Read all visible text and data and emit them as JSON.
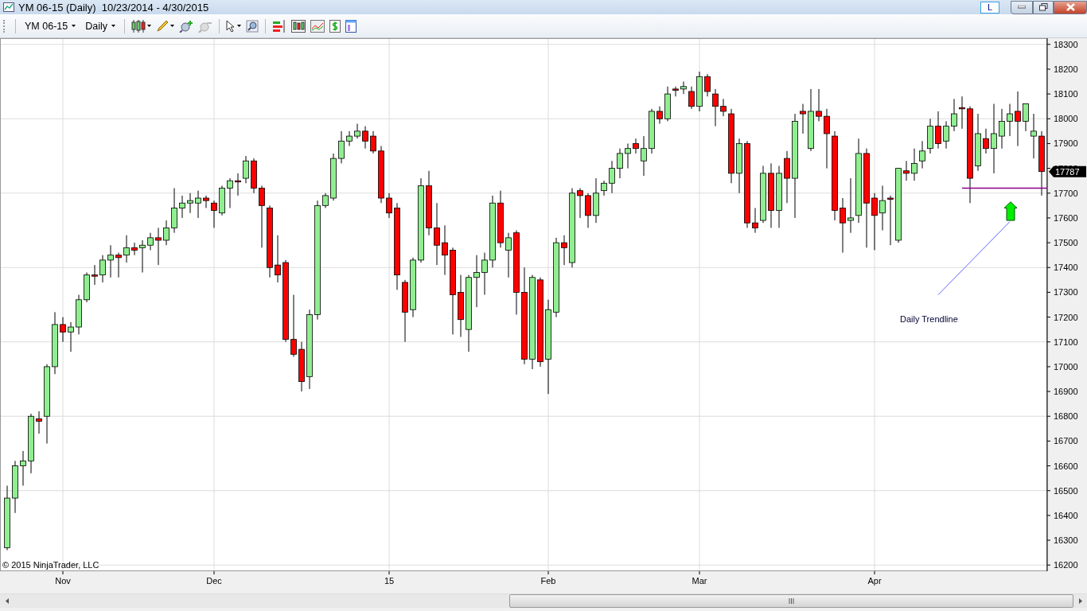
{
  "window": {
    "title": "YM 06-15 (Daily)  10/23/2014 - 4/30/2015",
    "layout_button": "L"
  },
  "toolbar": {
    "instrument": "YM 06-15",
    "interval": "Daily"
  },
  "chart": {
    "copyright": "© 2015 NinjaTrader, LLC",
    "last_price": "17787",
    "chart_data": {
      "type": "candlestick",
      "grid": true,
      "ylim": [
        16175,
        18325
      ],
      "yticks": [
        16200,
        16300,
        16400,
        16500,
        16600,
        16700,
        16800,
        16900,
        17000,
        17100,
        17200,
        17300,
        17400,
        17500,
        17600,
        17700,
        17800,
        17900,
        18000,
        18100,
        18200,
        18300
      ],
      "annotations": [
        "Daily Trendline"
      ],
      "categories": [
        null,
        null,
        null,
        null,
        null,
        null,
        null,
        "Nov",
        null,
        null,
        null,
        null,
        null,
        null,
        null,
        null,
        null,
        null,
        null,
        null,
        null,
        null,
        null,
        null,
        null,
        null,
        "Dec",
        null,
        null,
        null,
        null,
        null,
        null,
        null,
        null,
        null,
        null,
        null,
        null,
        null,
        null,
        null,
        null,
        null,
        null,
        null,
        null,
        null,
        "15",
        null,
        null,
        null,
        null,
        null,
        null,
        null,
        null,
        null,
        null,
        null,
        null,
        null,
        null,
        null,
        null,
        null,
        null,
        null,
        "Feb",
        null,
        null,
        null,
        null,
        null,
        null,
        null,
        null,
        null,
        null,
        null,
        null,
        null,
        null,
        null,
        null,
        null,
        null,
        "Mar",
        null,
        null,
        null,
        null,
        null,
        null,
        null,
        null,
        null,
        null,
        null,
        null,
        null,
        null,
        null,
        null,
        null,
        null,
        null,
        null,
        null,
        "Apr",
        null,
        null,
        null,
        null,
        null,
        null,
        null,
        null,
        null,
        null,
        null,
        null,
        null,
        null,
        null,
        null,
        null,
        null,
        null,
        null,
        null
      ],
      "ohlc": [
        [
          16270,
          16520,
          16260,
          16470
        ],
        [
          16470,
          16620,
          16410,
          16600
        ],
        [
          16600,
          16660,
          16520,
          16620
        ],
        [
          16620,
          16810,
          16570,
          16800
        ],
        [
          16790,
          16820,
          16730,
          16780
        ],
        [
          16800,
          17010,
          16690,
          17000
        ],
        [
          17000,
          17220,
          16970,
          17170
        ],
        [
          17170,
          17200,
          17100,
          17140
        ],
        [
          17140,
          17180,
          17060,
          17160
        ],
        [
          17160,
          17290,
          17130,
          17270
        ],
        [
          17270,
          17380,
          17260,
          17370
        ],
        [
          17370,
          17410,
          17330,
          17365
        ],
        [
          17370,
          17450,
          17340,
          17430
        ],
        [
          17430,
          17490,
          17360,
          17450
        ],
        [
          17450,
          17460,
          17360,
          17440
        ],
        [
          17450,
          17530,
          17420,
          17480
        ],
        [
          17480,
          17500,
          17450,
          17470
        ],
        [
          17480,
          17510,
          17380,
          17490
        ],
        [
          17490,
          17540,
          17470,
          17520
        ],
        [
          17520,
          17560,
          17410,
          17510
        ],
        [
          17510,
          17590,
          17490,
          17560
        ],
        [
          17560,
          17720,
          17540,
          17640
        ],
        [
          17640,
          17690,
          17600,
          17660
        ],
        [
          17660,
          17700,
          17620,
          17670
        ],
        [
          17660,
          17710,
          17600,
          17680
        ],
        [
          17680,
          17690,
          17640,
          17670
        ],
        [
          17660,
          17670,
          17560,
          17630
        ],
        [
          17620,
          17730,
          17610,
          17720
        ],
        [
          17720,
          17760,
          17640,
          17750
        ],
        [
          17750,
          17780,
          17690,
          17745
        ],
        [
          17760,
          17850,
          17740,
          17830
        ],
        [
          17830,
          17840,
          17700,
          17720
        ],
        [
          17720,
          17730,
          17480,
          17650
        ],
        [
          17640,
          17650,
          17360,
          17400
        ],
        [
          17410,
          17530,
          17340,
          17370
        ],
        [
          17420,
          17430,
          17100,
          17110
        ],
        [
          17110,
          17290,
          17040,
          17050
        ],
        [
          17070,
          17100,
          16900,
          16940
        ],
        [
          16960,
          17230,
          16910,
          17210
        ],
        [
          17210,
          17670,
          17190,
          17650
        ],
        [
          17650,
          17700,
          17640,
          17690
        ],
        [
          17680,
          17860,
          17670,
          17840
        ],
        [
          17840,
          17950,
          17820,
          17910
        ],
        [
          17910,
          17950,
          17890,
          17930
        ],
        [
          17930,
          17980,
          17920,
          17950
        ],
        [
          17950,
          17970,
          17880,
          17910
        ],
        [
          17930,
          17950,
          17860,
          17870
        ],
        [
          17870,
          17890,
          17660,
          17680
        ],
        [
          17680,
          17700,
          17600,
          17620
        ],
        [
          17640,
          17660,
          17310,
          17370
        ],
        [
          17340,
          17350,
          17100,
          17220
        ],
        [
          17230,
          17440,
          17200,
          17430
        ],
        [
          17430,
          17760,
          17420,
          17730
        ],
        [
          17730,
          17790,
          17530,
          17560
        ],
        [
          17560,
          17660,
          17410,
          17490
        ],
        [
          17500,
          17570,
          17370,
          17450
        ],
        [
          17470,
          17480,
          17130,
          17290
        ],
        [
          17300,
          17370,
          17120,
          17190
        ],
        [
          17150,
          17370,
          17060,
          17360
        ],
        [
          17360,
          17450,
          17240,
          17380
        ],
        [
          17380,
          17460,
          17290,
          17430
        ],
        [
          17430,
          17690,
          17400,
          17660
        ],
        [
          17660,
          17710,
          17480,
          17500
        ],
        [
          17470,
          17540,
          17360,
          17520
        ],
        [
          17540,
          17550,
          17210,
          17300
        ],
        [
          17300,
          17400,
          17010,
          17030
        ],
        [
          17030,
          17370,
          16990,
          17360
        ],
        [
          17350,
          17360,
          17000,
          17020
        ],
        [
          17030,
          17270,
          16890,
          17230
        ],
        [
          17220,
          17520,
          17200,
          17500
        ],
        [
          17500,
          17530,
          17410,
          17480
        ],
        [
          17420,
          17720,
          17400,
          17700
        ],
        [
          17710,
          17720,
          17600,
          17690
        ],
        [
          17690,
          17700,
          17560,
          17610
        ],
        [
          17610,
          17760,
          17580,
          17700
        ],
        [
          17710,
          17750,
          17690,
          17740
        ],
        [
          17740,
          17830,
          17700,
          17800
        ],
        [
          17800,
          17880,
          17760,
          17860
        ],
        [
          17860,
          17900,
          17800,
          17880
        ],
        [
          17900,
          17920,
          17860,
          17880
        ],
        [
          17830,
          17930,
          17770,
          17880
        ],
        [
          17880,
          18040,
          17860,
          18030
        ],
        [
          18030,
          18050,
          17980,
          18000
        ],
        [
          18000,
          18130,
          17990,
          18100
        ],
        [
          18120,
          18130,
          18090,
          18115
        ],
        [
          18120,
          18150,
          18100,
          18130
        ],
        [
          18110,
          18130,
          18040,
          18050
        ],
        [
          18050,
          18190,
          18030,
          18170
        ],
        [
          18170,
          18180,
          18090,
          18110
        ],
        [
          18100,
          18120,
          17970,
          18050
        ],
        [
          18050,
          18080,
          18010,
          18030
        ],
        [
          18020,
          18040,
          17740,
          17780
        ],
        [
          17780,
          17920,
          17700,
          17900
        ],
        [
          17900,
          17910,
          17560,
          17580
        ],
        [
          17580,
          17640,
          17540,
          17560
        ],
        [
          17590,
          17810,
          17580,
          17780
        ],
        [
          17780,
          17820,
          17560,
          17630
        ],
        [
          17630,
          17810,
          17560,
          17780
        ],
        [
          17840,
          17870,
          17660,
          17760
        ],
        [
          17760,
          18020,
          17600,
          17990
        ],
        [
          18030,
          18060,
          17940,
          18020
        ],
        [
          17880,
          18120,
          17870,
          18030
        ],
        [
          18030,
          18120,
          17990,
          18010
        ],
        [
          18010,
          18040,
          17800,
          17940
        ],
        [
          17930,
          17950,
          17590,
          17630
        ],
        [
          17640,
          17680,
          17460,
          17580
        ],
        [
          17590,
          17760,
          17540,
          17600
        ],
        [
          17610,
          17920,
          17580,
          17860
        ],
        [
          17860,
          17880,
          17480,
          17660
        ],
        [
          17680,
          17700,
          17470,
          17610
        ],
        [
          17620,
          17730,
          17550,
          17670
        ],
        [
          17680,
          17690,
          17490,
          17675
        ],
        [
          17510,
          17800,
          17500,
          17800
        ],
        [
          17790,
          17830,
          17750,
          17780
        ],
        [
          17780,
          17880,
          17750,
          17820
        ],
        [
          17830,
          17910,
          17800,
          17870
        ],
        [
          17880,
          18000,
          17860,
          17970
        ],
        [
          17970,
          18030,
          17880,
          17900
        ],
        [
          17910,
          17990,
          17880,
          17970
        ],
        [
          17970,
          18080,
          17950,
          18020
        ],
        [
          18045,
          18090,
          17960,
          18040
        ],
        [
          18040,
          18050,
          17660,
          17760
        ],
        [
          17810,
          18020,
          17790,
          17940
        ],
        [
          17920,
          17960,
          17860,
          17880
        ],
        [
          17880,
          18060,
          17780,
          17940
        ],
        [
          17930,
          18040,
          17880,
          17990
        ],
        [
          17990,
          18060,
          17930,
          18020
        ],
        [
          18030,
          18110,
          17890,
          17990
        ],
        [
          17990,
          18060,
          17950,
          18060
        ],
        [
          17930,
          18020,
          17840,
          17950
        ],
        [
          17930,
          17950,
          17690,
          17787
        ]
      ]
    }
  }
}
